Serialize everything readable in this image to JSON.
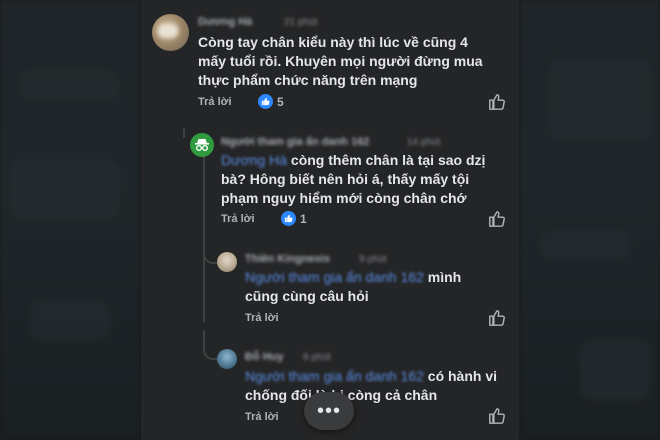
{
  "comments": [
    {
      "author": "Dương Hà",
      "time": "21 phút",
      "text": "Còng tay chân kiểu này thì lúc về cũng 4 mấy tuổi rồi. Khuyên mọi người đừng mua thực phẩm chức năng trên mạng",
      "reply_label": "Trả lời",
      "reaction_count": "5"
    },
    {
      "author": "Người tham gia ẩn danh 162",
      "time": "14 phút",
      "mention": "Dương Hà",
      "text": " còng thêm chân là tại sao dzị bà? Hông biết nên hỏi á, thấy mấy tội phạm nguy hiểm mới còng chân chớ",
      "reply_label": "Trả lời",
      "reaction_count": "1"
    },
    {
      "author": "Thiên Kingnesis",
      "time": "9 phút",
      "mention": "Người tham gia ẩn danh 162",
      "text": " mình cũng cùng câu hỏi",
      "reply_label": "Trả lời"
    },
    {
      "author": "Đỗ Huy",
      "time": "8 phút",
      "mention": "Người tham gia ẩn danh 162",
      "text": " có hành vi chống đối là bị còng cả chân",
      "reply_label": "Trả lời"
    }
  ],
  "more_button": "•••",
  "icons": {
    "reaction": "like-reaction-icon",
    "like": "thumbs-up-icon",
    "anonymous": "anonymous-spy-icon"
  },
  "colors": {
    "panel": "#242526",
    "mention": "#5b8ee6",
    "reaction": "#2d88ff",
    "anonymous_avatar": "#2f9a3f"
  }
}
